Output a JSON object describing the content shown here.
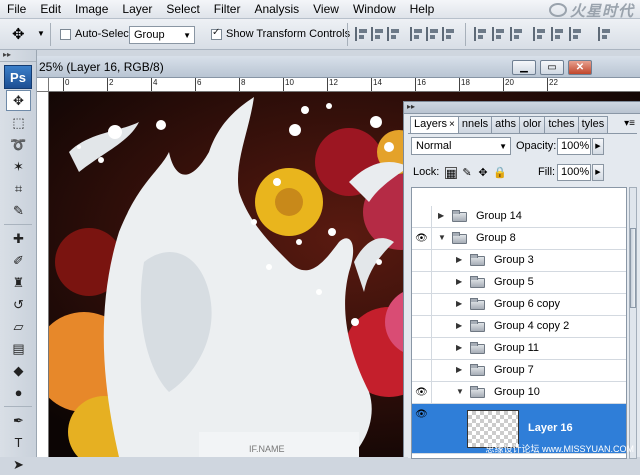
{
  "menu": [
    "File",
    "Edit",
    "Image",
    "Layer",
    "Select",
    "Filter",
    "Analysis",
    "View",
    "Window",
    "Help"
  ],
  "options": {
    "auto_select_label": "Auto-Select:",
    "auto_select_value": "Group",
    "show_transform_label": "Show Transform Controls"
  },
  "toolbox": {
    "badge": "Ps"
  },
  "document": {
    "title": "25% (Layer 16, RGB/8)",
    "ruler_ticks": [
      "0",
      "2",
      "4",
      "6",
      "8",
      "10",
      "12",
      "14",
      "16",
      "18",
      "20",
      "22"
    ]
  },
  "layers_panel": {
    "tabs": [
      "Layers",
      "nnels",
      "aths",
      "olor",
      "tches",
      "tyles"
    ],
    "blend_mode": "Normal",
    "opacity_label": "Opacity:",
    "opacity_value": "100%",
    "lock_label": "Lock:",
    "fill_label": "Fill:",
    "fill_value": "100%",
    "layers": [
      {
        "name": "Group 14",
        "visible": false,
        "expanded": false,
        "indent": 0
      },
      {
        "name": "Group 8",
        "visible": true,
        "expanded": true,
        "indent": 0
      },
      {
        "name": "Group 3",
        "visible": false,
        "expanded": false,
        "indent": 1
      },
      {
        "name": "Group 5",
        "visible": false,
        "expanded": false,
        "indent": 1
      },
      {
        "name": "Group 6 copy",
        "visible": false,
        "expanded": false,
        "indent": 1
      },
      {
        "name": "Group 4 copy 2",
        "visible": false,
        "expanded": false,
        "indent": 1
      },
      {
        "name": "Group 11",
        "visible": false,
        "expanded": false,
        "indent": 1
      },
      {
        "name": "Group 7",
        "visible": false,
        "expanded": false,
        "indent": 1
      },
      {
        "name": "Group 10",
        "visible": true,
        "expanded": true,
        "indent": 1
      },
      {
        "name": "Layer 16",
        "visible": true,
        "selected": true,
        "indent": 2
      }
    ]
  },
  "watermark": "思缘设计论坛 www.MISSYUAN.COM",
  "colors": {
    "selection": "#2f7ed8",
    "panel_bg": "#e4e9ef"
  }
}
